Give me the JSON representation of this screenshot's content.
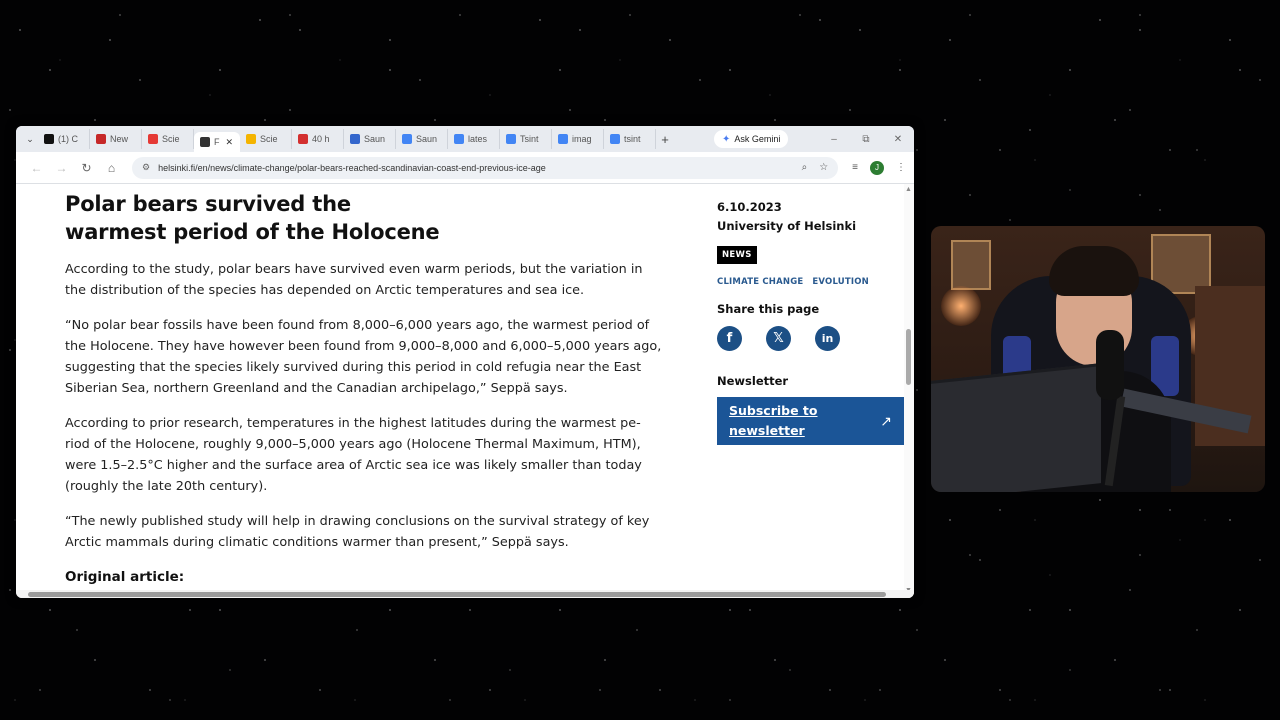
{
  "browser": {
    "tabs": [
      {
        "icon": "x-logo-icon",
        "label": "(1) C",
        "color": "#111111"
      },
      {
        "icon": "news-icon",
        "label": "New",
        "color": "#c62828"
      },
      {
        "icon": "science-icon",
        "label": "Scie",
        "color": "#e53935"
      },
      {
        "icon": "bear-icon",
        "label": "F",
        "color": "#333333",
        "active": true
      },
      {
        "icon": "science-icon",
        "label": "Scie",
        "color": "#f4b400"
      },
      {
        "icon": "cbc-icon",
        "label": "40 h",
        "color": "#d32f2f"
      },
      {
        "icon": "wiki-icon",
        "label": "Saun",
        "color": "#3366cc"
      },
      {
        "icon": "google-icon",
        "label": "Saun",
        "color": "#4285f4"
      },
      {
        "icon": "google-icon",
        "label": "lates",
        "color": "#4285f4"
      },
      {
        "icon": "google-icon",
        "label": "Tsint",
        "color": "#4285f4"
      },
      {
        "icon": "google-icon",
        "label": "imag",
        "color": "#4285f4"
      },
      {
        "icon": "google-icon",
        "label": "tsint",
        "color": "#4285f4"
      }
    ],
    "gemini_label": "Ask Gemini",
    "url": "helsinki.fi/en/news/climate-change/polar-bears-reached-scandinavian-coast-end-previous-ice-age",
    "profile_initial": "J"
  },
  "article": {
    "title_line1": "Polar bears survived the",
    "title_line2": "warmest period of the Holocene",
    "paragraphs": [
      "According to the study, polar bears have survived even warm periods, but the variation in the distribution of the species has depended on Arctic temperatures and sea ice.",
      "“No polar bear fossils have been found from 8,000–6,000 years ago, the warmest period of the Holocene. They have however been found from 9,000–8,000 and 6,000–5,000 years ago, suggesting that the species likely survived during this period in cold refugia near the East Siberian Sea, northern Greenland and the Canadian archipelago,” Seppä says.",
      "According to prior research, temperatures in the highest latitudes during the warmest pe-riod of the Holocene, roughly 9,000–5,000 years ago (Holocene Thermal Maximum, HTM), were 1.5–2.5°C higher and the surface area of Arctic sea ice was likely smaller than today (roughly the late 20th century).",
      "“The newly published study will help in drawing conclusions on the survival strategy of key Arctic mammals during climatic conditions warmer than present,” Seppä says."
    ],
    "original_heading": "Original article:"
  },
  "sidebar": {
    "date": "6.10.2023",
    "organization": "University of Helsinki",
    "badge": "NEWS",
    "tags": [
      "CLIMATE CHANGE",
      "EVOLUTION"
    ],
    "share_heading": "Share this page",
    "social": [
      {
        "icon": "facebook-icon",
        "glyph": "f"
      },
      {
        "icon": "x-icon",
        "glyph": "𝕏"
      },
      {
        "icon": "linkedin-icon",
        "glyph": "in"
      }
    ],
    "newsletter_heading": "Newsletter",
    "subscribe_label": "Subscribe to newsletter"
  },
  "colors": {
    "accent_blue": "#1b5597",
    "social_blue": "#1c4f85",
    "tag_blue": "#2a5a8f"
  }
}
